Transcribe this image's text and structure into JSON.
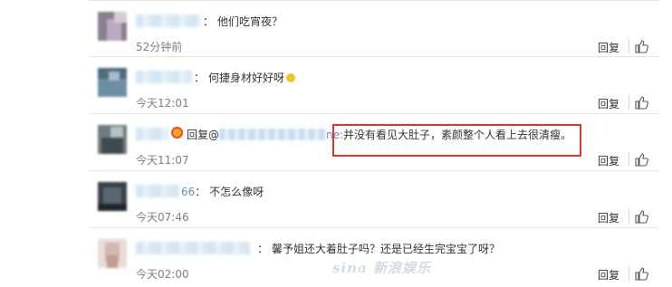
{
  "comments": [
    {
      "text": "他们吃宵夜？",
      "time": "52分钟前",
      "reply": "回复"
    },
    {
      "text": "何捷身材好好呀",
      "time": "今天12:01",
      "reply": "回复"
    },
    {
      "reply_prefix": "回复@",
      "link_tail": "ne:",
      "text": "并没有看见大肚子，素颜整个人看上去很清瘦。",
      "time": "今天11:07",
      "reply": "回复"
    },
    {
      "name_tail": "66",
      "text": "不怎么像呀",
      "time": "今天07:46",
      "reply": "回复"
    },
    {
      "text": "馨予姐还大着肚子吗？还是已经生完宝宝了呀？",
      "time": "今天02:00",
      "reply": "回复"
    }
  ],
  "colon": "：",
  "watermark": "sina 新浪娱乐",
  "colors": {
    "highlight": "#e2342f",
    "time": "#808080",
    "divider": "#e6e6e6"
  },
  "icons": [
    "thumbs-up-icon",
    "smile-emoji-icon",
    "crown-badge-icon"
  ]
}
